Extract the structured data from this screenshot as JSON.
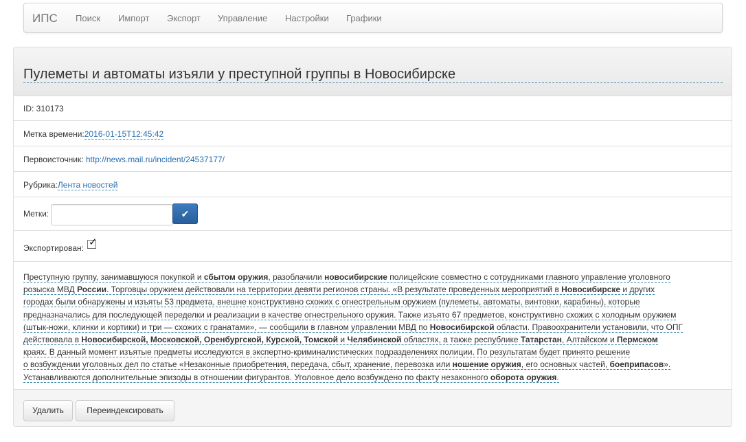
{
  "nav": {
    "brand": "ИПС",
    "items": [
      "Поиск",
      "Импорт",
      "Экспорт",
      "Управление",
      "Настройки",
      "Графики"
    ]
  },
  "panel": {
    "title": "Пулеметы и автоматы изъяли у преступной группы в Новосибирске",
    "id_text": "ID: 310173",
    "timestamp_label": "Метка времени:",
    "timestamp_value": "2016-01-15T12:45:42",
    "source_label": "Первоисточник:",
    "source_url": "http://news.mail.ru/incident/24537177/",
    "rubric_label": "Рубрика:",
    "rubric_value": "Лента новостей",
    "tags_label": "Метки:",
    "tags_value": "",
    "exported_label": "Экспортирован:",
    "exported_checked": true,
    "check_icon": "checkmark-icon"
  },
  "body_lines": [
    [
      [
        "Преступную группу, занимавшуюся покупкой и ",
        0
      ],
      [
        "сбытом оружия",
        1
      ],
      [
        ", разоблачили ",
        0
      ],
      [
        "новосибирские",
        1
      ],
      [
        " полицейские совместно с сотрудниками главного управление уголовного",
        0
      ]
    ],
    [
      [
        "розыска МВД ",
        0
      ],
      [
        "России",
        1
      ],
      [
        ". Торговцы оружием действовали на территории девяти регионов страны. «В результате проведенных мероприятий в ",
        0
      ],
      [
        "Новосибирске",
        1
      ],
      [
        " и других",
        0
      ]
    ],
    [
      [
        "городах были обнаружены и изъяты 53 предмета, внешне конструктивно схожих с огнестрельным оружием (пулеметы, автоматы, винтовки, карабины), которые",
        0
      ]
    ],
    [
      [
        "предназначались для последующей переделки и реализации в качестве огнестрельного оружия. Также изъято 67 предметов, конструктивно схожих с холодным оружием",
        0
      ]
    ],
    [
      [
        "(штык-ножи, клинки и кортики) и три — схожих с гранатами», — сообщили в главном управлении МВД по ",
        0
      ],
      [
        "Новосибирской",
        1
      ],
      [
        " области. Правоохранители установили, что ОПГ",
        0
      ]
    ],
    [
      [
        "действовала в ",
        0
      ],
      [
        "Новосибирской, Московской, Оренбургской, Курской, Томской",
        1
      ],
      [
        " и ",
        0
      ],
      [
        "Челябинской",
        1
      ],
      [
        " областях, а также республике ",
        0
      ],
      [
        "Татарстан",
        1
      ],
      [
        ", Алтайском и ",
        0
      ],
      [
        "Пермском",
        1
      ]
    ],
    [
      [
        "краях. В данный момент изъятые предметы исследуются в экспертно-криминалистических подразделениях полиции. По результатам будет принято решение",
        0
      ]
    ],
    [
      [
        "о возбуждении уголовных дел по статье «Незаконные приобретения, передача, сбыт, хранение, перевозка или ",
        0
      ],
      [
        "ношение оружия",
        1
      ],
      [
        ", его основных частей, ",
        0
      ],
      [
        "боеприпасов",
        1
      ],
      [
        "».",
        0
      ]
    ],
    [
      [
        "Устанавливаются дополнительные эпизоды в отношении фигурантов. Уголовное дело возбуждено по факту незаконного ",
        0
      ],
      [
        "оборота оружия",
        1
      ],
      [
        ".",
        0
      ]
    ]
  ],
  "footer": {
    "delete_label": "Удалить",
    "reindex_label": "Переиндексировать"
  }
}
